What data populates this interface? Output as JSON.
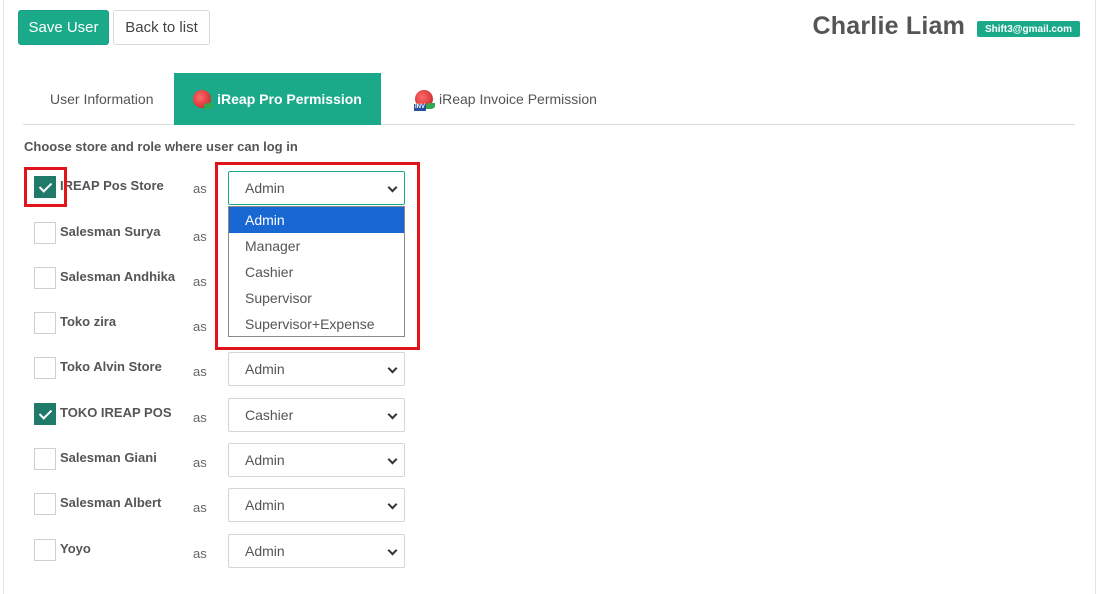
{
  "toolbar": {
    "save_label": "Save User",
    "back_label": "Back to list"
  },
  "user": {
    "name": "Charlie Liam",
    "email": "Shift3@gmail.com"
  },
  "tabs": [
    {
      "label": "User Information",
      "active": false
    },
    {
      "label": "iReap Pro Permission",
      "active": true,
      "icon": "ireap-pro-icon"
    },
    {
      "label": "iReap Invoice Permission",
      "active": false,
      "icon": "ireap-invoice-icon",
      "icon_text": "INV"
    }
  ],
  "section": {
    "title": "Choose store and role where user can log in"
  },
  "as_label": "as",
  "stores": [
    {
      "name": "IREAP Pos Store",
      "checked": true,
      "role": "Admin"
    },
    {
      "name": "Salesman Surya",
      "checked": false,
      "role": ""
    },
    {
      "name": "Salesman Andhika",
      "checked": false,
      "role": ""
    },
    {
      "name": "Toko zira",
      "checked": false,
      "role": ""
    },
    {
      "name": "Toko Alvin Store",
      "checked": false,
      "role": "Admin"
    },
    {
      "name": "TOKO IREAP POS",
      "checked": true,
      "role": "Cashier"
    },
    {
      "name": "Salesman Giani",
      "checked": false,
      "role": "Admin"
    },
    {
      "name": "Salesman Albert",
      "checked": false,
      "role": "Admin"
    },
    {
      "name": "Yoyo",
      "checked": false,
      "role": "Admin"
    }
  ],
  "dropdown": {
    "options": [
      "Admin",
      "Manager",
      "Cashier",
      "Supervisor",
      "Supervisor+Expense"
    ],
    "selected": "Admin"
  },
  "colors": {
    "accent": "#1aaa8a",
    "highlight": "#e1141a",
    "option_selected": "#1967d2"
  }
}
